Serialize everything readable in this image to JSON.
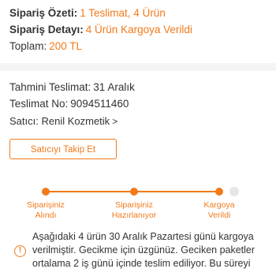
{
  "summary": {
    "order_summary_label": "Sipariş Özeti:",
    "order_summary_value": "1 Teslimat, 4 Ürün",
    "order_detail_label": "Sipariş Detayı:",
    "order_detail_value": "4 Ürün Kargoya Verildi",
    "total_label": "Toplam:",
    "total_value": "200 TL"
  },
  "delivery": {
    "estimated_label": "Tahmini Teslimat:",
    "estimated_value": "31 Aralık",
    "delivery_no_label": "Teslimat No:",
    "delivery_no_value": "9094511460",
    "seller_label": "Satıcı:",
    "seller_value": "Renil Kozmetik",
    "seller_chevron": ">",
    "follow_button": "Satıcıyı Takip Et"
  },
  "tracker": {
    "steps": [
      {
        "line1": "Siparişiniz",
        "line2": "Alındı"
      },
      {
        "line1": "Siparişiniz",
        "line2": "Hazırlanıyor"
      },
      {
        "line1": "Kargoya",
        "line2": "Verildi"
      }
    ]
  },
  "notice": {
    "icon": "info-icon",
    "icon_glyph": "!",
    "text": "Aşağıdaki 4 ürün 30 Aralık Pazartesi günü kargoya verilmiştir. Gecikme için üzgünüz. Geciken paketler ortalama 2 iş günü içinde teslim ediliyor. Bu süreyi"
  },
  "colors": {
    "accent": "#f27a1a",
    "text": "#333333",
    "divider": "#f4f4f4",
    "inactive_step": "#e6e6e6"
  }
}
